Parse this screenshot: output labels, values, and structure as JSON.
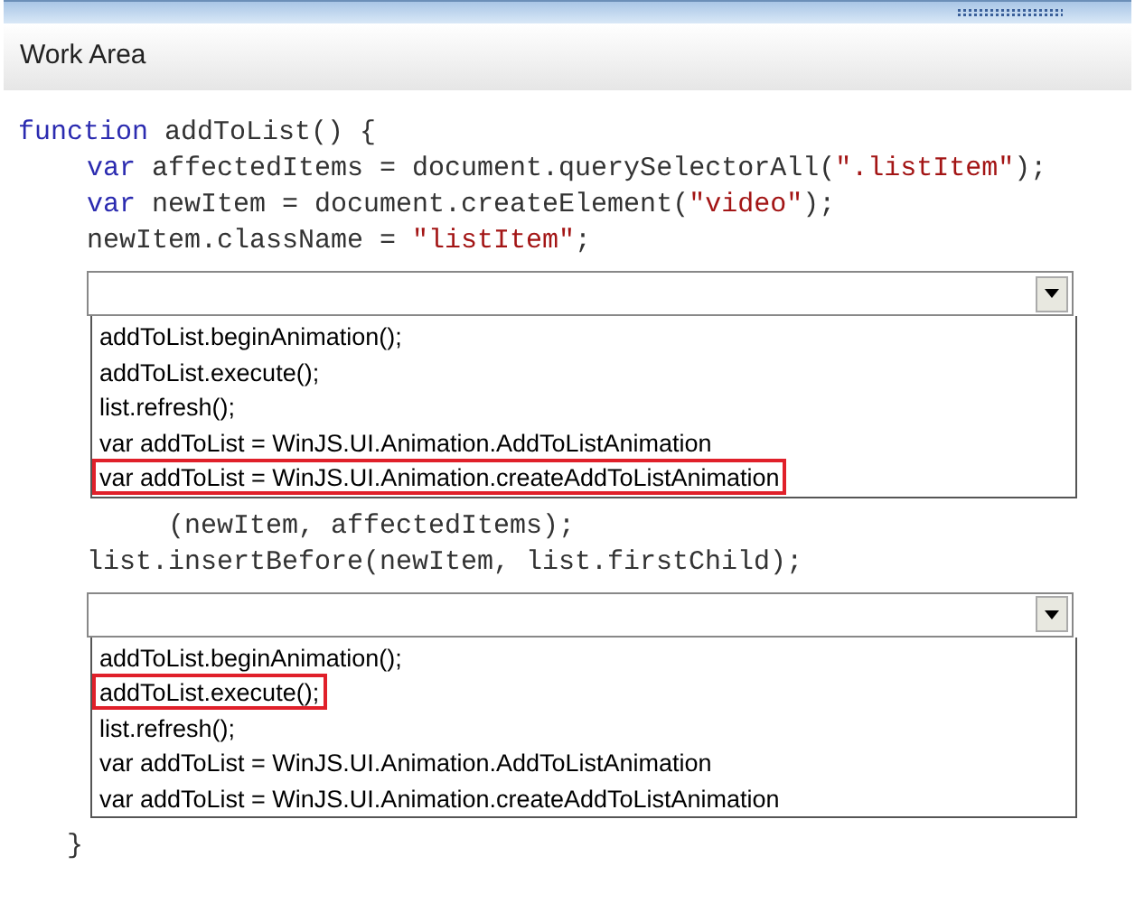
{
  "panel": {
    "title": "Work Area"
  },
  "blocks": [
    {
      "kind": "code",
      "indent": false,
      "tokens": [
        {
          "kind": "keyword",
          "text": "function"
        },
        {
          "kind": "plain",
          "text": " addToList() {"
        }
      ]
    },
    {
      "kind": "code",
      "indent": true,
      "tokens": [
        {
          "kind": "keyword",
          "text": "var"
        },
        {
          "kind": "plain",
          "text": " affectedItems = document.querySelectorAll("
        },
        {
          "kind": "string",
          "text": "\".listItem\""
        },
        {
          "kind": "plain",
          "text": ");"
        }
      ]
    },
    {
      "kind": "code",
      "indent": true,
      "tokens": [
        {
          "kind": "keyword",
          "text": "var"
        },
        {
          "kind": "plain",
          "text": " newItem = document.createElement("
        },
        {
          "kind": "string",
          "text": "\"video\""
        },
        {
          "kind": "plain",
          "text": ");"
        }
      ]
    },
    {
      "kind": "code",
      "indent": true,
      "tokens": [
        {
          "kind": "plain",
          "text": "newItem.className = "
        },
        {
          "kind": "string",
          "text": "\"listItem\""
        },
        {
          "kind": "plain",
          "text": ";"
        }
      ]
    },
    {
      "kind": "dropdown",
      "options": [
        {
          "label": "addToList.beginAnimation();",
          "selected": false
        },
        {
          "label": "addToList.execute();",
          "selected": false
        },
        {
          "label": "list.refresh();",
          "selected": false
        },
        {
          "label": "var addToList = WinJS.UI.Animation.AddToListAnimation",
          "selected": false
        },
        {
          "label": "var addToList = WinJS.UI.Animation.createAddToListAnimation",
          "selected": true
        }
      ]
    },
    {
      "kind": "code",
      "indent": true,
      "tokens": [
        {
          "kind": "plain",
          "text": "     (newItem, affectedItems);"
        }
      ]
    },
    {
      "kind": "code",
      "indent": true,
      "tokens": [
        {
          "kind": "plain",
          "text": "list.insertBefore(newItem, list.firstChild);"
        }
      ]
    },
    {
      "kind": "dropdown",
      "options": [
        {
          "label": "addToList.beginAnimation();",
          "selected": false
        },
        {
          "label": "addToList.execute();",
          "selected": true
        },
        {
          "label": "list.refresh();",
          "selected": false
        },
        {
          "label": "var addToList = WinJS.UI.Animation.AddToListAnimation",
          "selected": false
        },
        {
          "label": "var addToList = WinJS.UI.Animation.createAddToListAnimation",
          "selected": false
        }
      ]
    },
    {
      "kind": "code",
      "indent": false,
      "tokens": [
        {
          "kind": "plain",
          "text": "   }"
        }
      ]
    }
  ]
}
